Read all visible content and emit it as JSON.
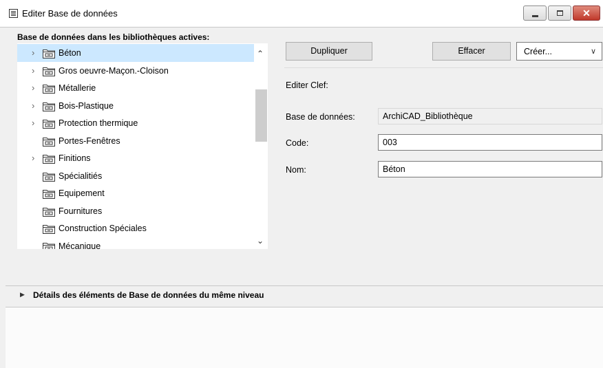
{
  "window": {
    "title": "Editer Base de données"
  },
  "tree": {
    "heading": "Base de données dans les bibliothèques actives:",
    "items": [
      {
        "label": "Béton",
        "expandable": true,
        "selected": true
      },
      {
        "label": "Gros oeuvre-Maçon.-Cloison",
        "expandable": true
      },
      {
        "label": "Métallerie",
        "expandable": true
      },
      {
        "label": "Bois-Plastique",
        "expandable": true
      },
      {
        "label": "Protection thermique",
        "expandable": true
      },
      {
        "label": "Portes-Fenêtres",
        "expandable": false
      },
      {
        "label": "Finitions",
        "expandable": true
      },
      {
        "label": "Spécialitiés",
        "expandable": false
      },
      {
        "label": "Equipement",
        "expandable": false
      },
      {
        "label": "Fournitures",
        "expandable": false
      },
      {
        "label": "Construction Spéciales",
        "expandable": false
      },
      {
        "label": "Mécanique",
        "expandable": false
      }
    ]
  },
  "buttons": {
    "duplicate": "Dupliquer",
    "delete": "Effacer",
    "create": "Créer..."
  },
  "edit_key_label": "Editer Clef:",
  "fields": {
    "database_label": "Base de données:",
    "database_value": "ArchiCAD_Bibliothèque",
    "code_label": "Code:",
    "code_value": "003",
    "name_label": "Nom:",
    "name_value": "Béton"
  },
  "details_label": "Détails des éléments de Base de données du même niveau",
  "colors": {
    "selection": "#cce8ff",
    "close_button": "#c0392b"
  }
}
